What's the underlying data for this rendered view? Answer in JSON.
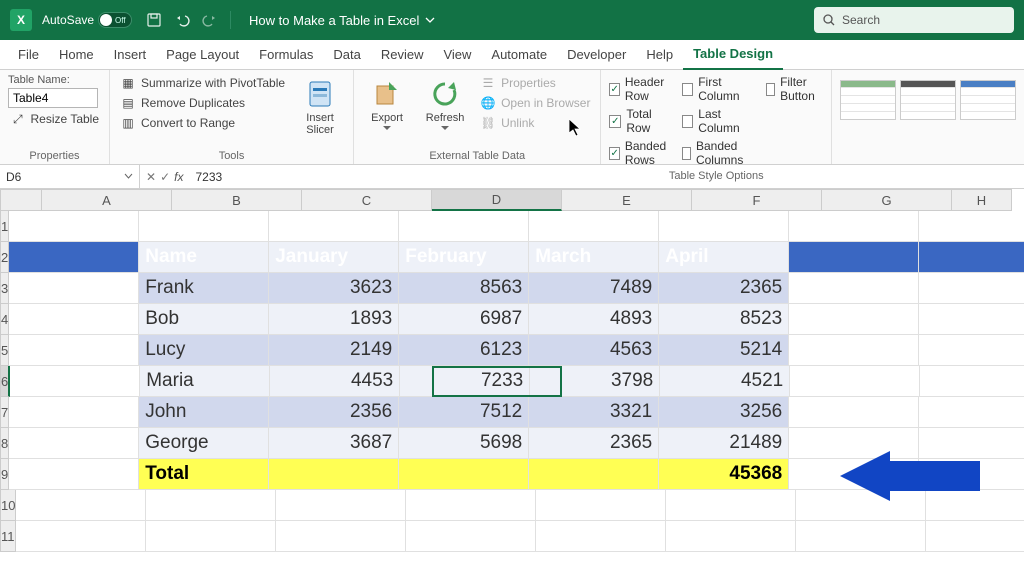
{
  "titlebar": {
    "autosave_label": "AutoSave",
    "autosave_state": "Off",
    "doc_title": "How to Make a Table in Excel",
    "search_placeholder": "Search"
  },
  "tabs": [
    "File",
    "Home",
    "Insert",
    "Page Layout",
    "Formulas",
    "Data",
    "Review",
    "View",
    "Automate",
    "Developer",
    "Help",
    "Table Design"
  ],
  "active_tab": "Table Design",
  "ribbon": {
    "properties": {
      "label": "Properties",
      "table_name_label": "Table Name:",
      "table_name_value": "Table4",
      "resize": "Resize Table"
    },
    "tools": {
      "label": "Tools",
      "summarize": "Summarize with PivotTable",
      "dupes": "Remove Duplicates",
      "convert": "Convert to Range",
      "slicer": "Insert Slicer"
    },
    "ext": {
      "label": "External Table Data",
      "export": "Export",
      "refresh": "Refresh",
      "props": "Properties",
      "browser": "Open in Browser",
      "unlink": "Unlink"
    },
    "opts": {
      "label": "Table Style Options",
      "header_row": "Header Row",
      "total_row": "Total Row",
      "banded_rows": "Banded Rows",
      "first_col": "First Column",
      "last_col": "Last Column",
      "banded_cols": "Banded Columns",
      "filter": "Filter Button"
    }
  },
  "fbar": {
    "cell_ref": "D6",
    "value": "7233"
  },
  "columns": [
    "A",
    "B",
    "C",
    "D",
    "E",
    "F",
    "G",
    "H"
  ],
  "row_numbers": [
    "1",
    "2",
    "3",
    "4",
    "5",
    "6",
    "7",
    "8",
    "9",
    "10",
    "11"
  ],
  "chart_data": {
    "type": "table",
    "headers": [
      "Name",
      "January",
      "February",
      "March",
      "April"
    ],
    "rows": [
      [
        "Frank",
        3623,
        8563,
        7489,
        2365
      ],
      [
        "Bob",
        1893,
        6987,
        4893,
        8523
      ],
      [
        "Lucy",
        2149,
        6123,
        4563,
        5214
      ],
      [
        "Maria",
        4453,
        7233,
        3798,
        4521
      ],
      [
        "John",
        2356,
        7512,
        3321,
        3256
      ],
      [
        "George",
        3687,
        5698,
        2365,
        21489
      ]
    ],
    "total_label": "Total",
    "total_value": 45368
  }
}
